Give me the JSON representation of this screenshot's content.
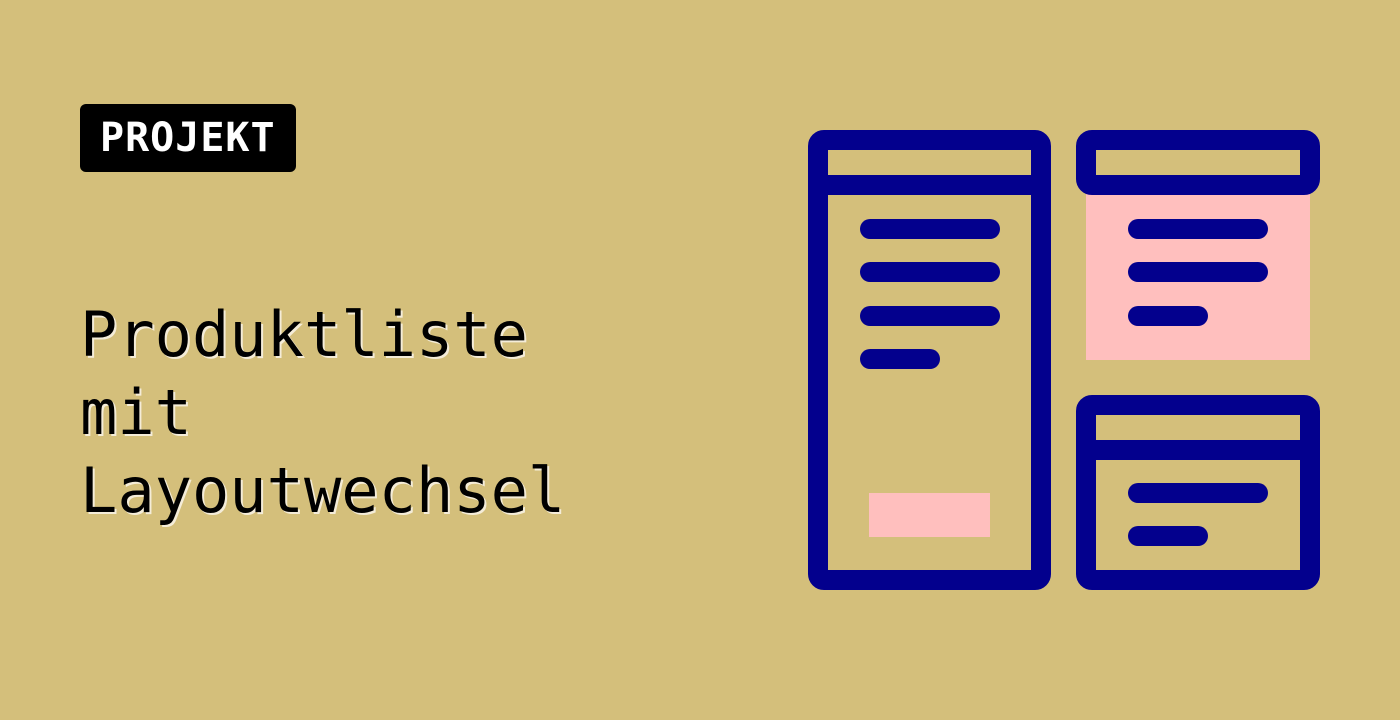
{
  "badge": {
    "label": "PROJEKT"
  },
  "title": {
    "lines": [
      "Produktliste",
      "mit",
      "Layoutwechsel"
    ]
  },
  "colors": {
    "background": "#d4bf7b",
    "badge_background": "#000000",
    "badge_text": "#ffffff",
    "title_text": "#000000",
    "illustration_stroke": "#03008d",
    "illustration_highlight": "#ffbfbe"
  },
  "illustration": {
    "icon": "layout-switch-illustration"
  }
}
